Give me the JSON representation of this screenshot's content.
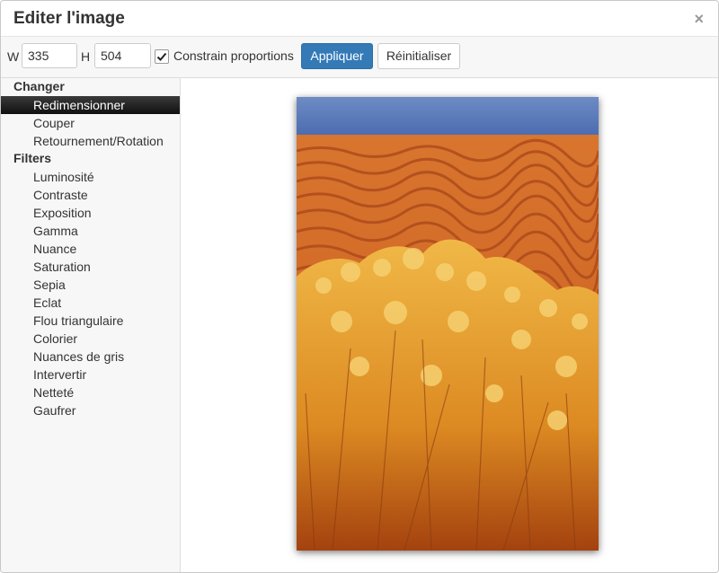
{
  "dialog": {
    "title": "Editer l'image",
    "close_glyph": "×"
  },
  "toolbar": {
    "width_label": "W",
    "width_value": "335",
    "height_label": "H",
    "height_value": "504",
    "constrain_checked": true,
    "constrain_label": "Constrain proportions",
    "apply_label": "Appliquer",
    "reset_label": "Réinitialiser"
  },
  "sidebar": {
    "sections": [
      {
        "title": "Changer",
        "items": [
          "Redimensionner",
          "Couper",
          "Retournement/Rotation"
        ]
      },
      {
        "title": "Filters",
        "items": [
          "Luminosité",
          "Contraste",
          "Exposition",
          "Gamma",
          "Nuance",
          "Saturation",
          "Sepia",
          "Eclat",
          "Flou triangulaire",
          "Colorier",
          "Nuances de gris",
          "Intervertir",
          "Netteté",
          "Gaufrer"
        ]
      }
    ],
    "active_item": "Redimensionner"
  },
  "preview": {
    "image_subject": "desert sand dunes with golden shrubs"
  },
  "colors": {
    "primary": "#337ab7",
    "active_item_bg": "#222222",
    "sky": "#4a6fb3",
    "sand": "#d2691e"
  }
}
